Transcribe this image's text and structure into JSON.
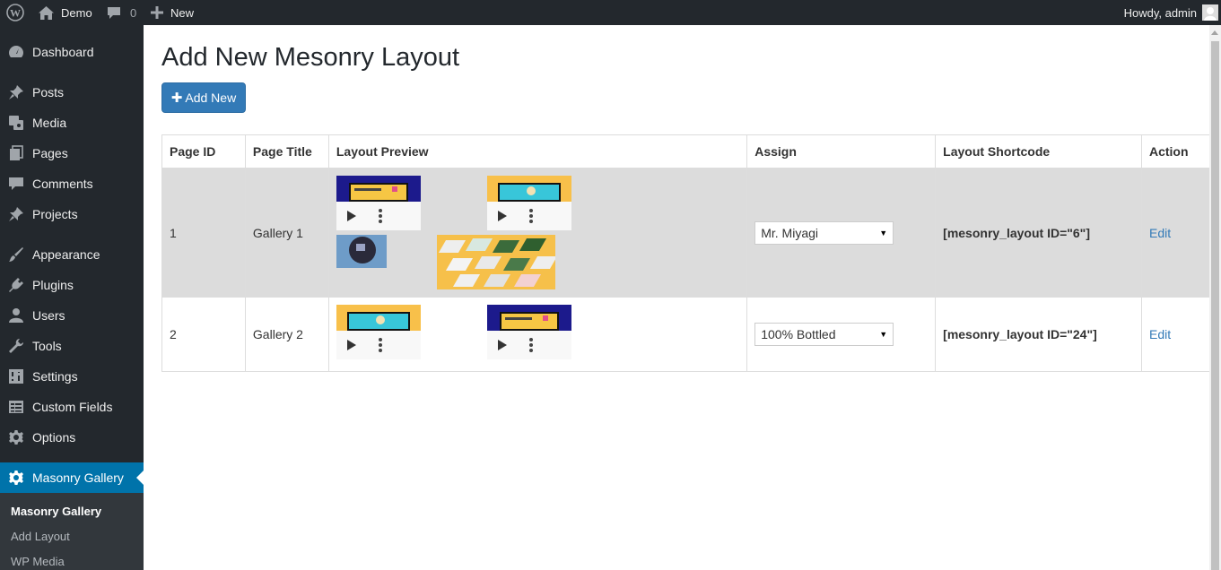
{
  "adminbar": {
    "site_name": "Demo",
    "comments_count": "0",
    "new_label": "New",
    "howdy": "Howdy, admin"
  },
  "sidebar": {
    "items": [
      {
        "label": "Dashboard",
        "icon": "dashboard-icon"
      },
      {
        "label": "Posts",
        "icon": "pin-icon"
      },
      {
        "label": "Media",
        "icon": "media-icon"
      },
      {
        "label": "Pages",
        "icon": "pages-icon"
      },
      {
        "label": "Comments",
        "icon": "comments-icon"
      },
      {
        "label": "Projects",
        "icon": "pin-icon"
      },
      {
        "label": "Appearance",
        "icon": "brush-icon"
      },
      {
        "label": "Plugins",
        "icon": "plug-icon"
      },
      {
        "label": "Users",
        "icon": "user-icon"
      },
      {
        "label": "Tools",
        "icon": "wrench-icon"
      },
      {
        "label": "Settings",
        "icon": "settings-icon"
      },
      {
        "label": "Custom Fields",
        "icon": "table-icon"
      },
      {
        "label": "Options",
        "icon": "gear-icon"
      },
      {
        "label": "Masonry Gallery",
        "icon": "gear-icon"
      }
    ],
    "submenu": [
      {
        "label": "Masonry Gallery"
      },
      {
        "label": "Add Layout"
      },
      {
        "label": "WP Media"
      }
    ]
  },
  "main": {
    "title": "Add New Mesonry Layout",
    "add_new_label": "Add New"
  },
  "table": {
    "headers": [
      "Page ID",
      "Page Title",
      "Layout Preview",
      "Assign",
      "Layout Shortcode",
      "Action"
    ],
    "rows": [
      {
        "id": "1",
        "title": "Gallery 1",
        "assign": "Mr. Miyagi",
        "shortcode": "[mesonry_layout ID=\"6\"]",
        "action": "Edit"
      },
      {
        "id": "2",
        "title": "Gallery 2",
        "assign": "100% Bottled",
        "shortcode": "[mesonry_layout ID=\"24\"]",
        "action": "Edit"
      }
    ]
  },
  "colors": {
    "adminbar_bg": "#23282d",
    "accent": "#0073aa",
    "button": "#337ab7",
    "row_highlight": "#dcdcdc"
  }
}
